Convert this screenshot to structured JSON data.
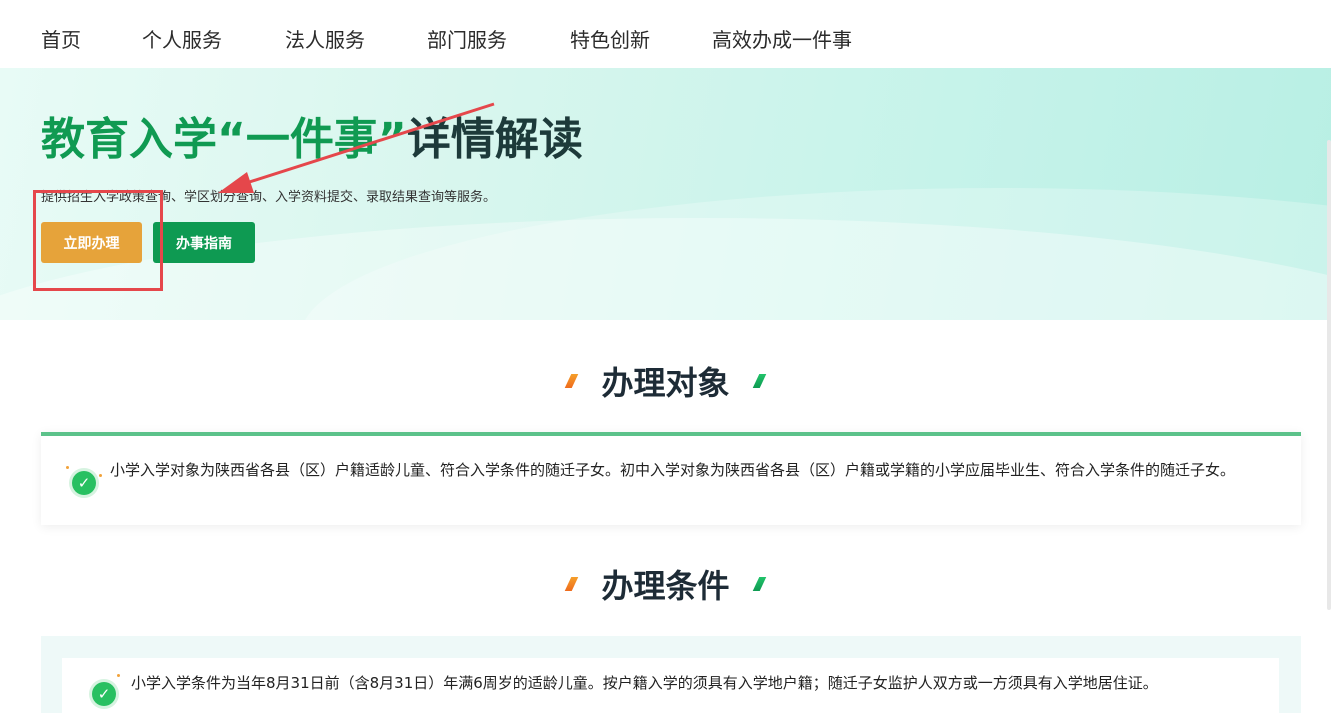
{
  "nav": {
    "items": [
      "首页",
      "个人服务",
      "法人服务",
      "部门服务",
      "特色创新",
      "高效办成一件事"
    ]
  },
  "hero": {
    "title_green_1": "教育入学",
    "title_green_2": "“一件事”",
    "title_dark": "详情解读",
    "description": "提供招生入学政策查询、学区划分查询、入学资料提交、录取结果查询等服务。",
    "primary_button": "立即办理",
    "secondary_button": "办事指南"
  },
  "sections": [
    {
      "title": "办理对象",
      "text": "小学入学对象为陕西省各县（区）户籍适龄儿童、符合入学条件的随迁子女。初中入学对象为陕西省各县（区）户籍或学籍的小学应届毕业生、符合入学条件的随迁子女。"
    },
    {
      "title": "办理条件",
      "text": "小学入学条件为当年8月31日前（含8月31日）年满6周岁的适龄儿童。按户籍入学的须具有入学地户籍；随迁子女监护人双方或一方须具有入学地居住证。"
    }
  ],
  "colors": {
    "brand_green": "#109a52",
    "orange_button": "#e6a33a",
    "annotation_red": "#e5474b"
  },
  "icons": {
    "check": "check-circle-icon",
    "section_mark_left": "orange-slash-icon",
    "section_mark_right": "green-slash-icon"
  }
}
